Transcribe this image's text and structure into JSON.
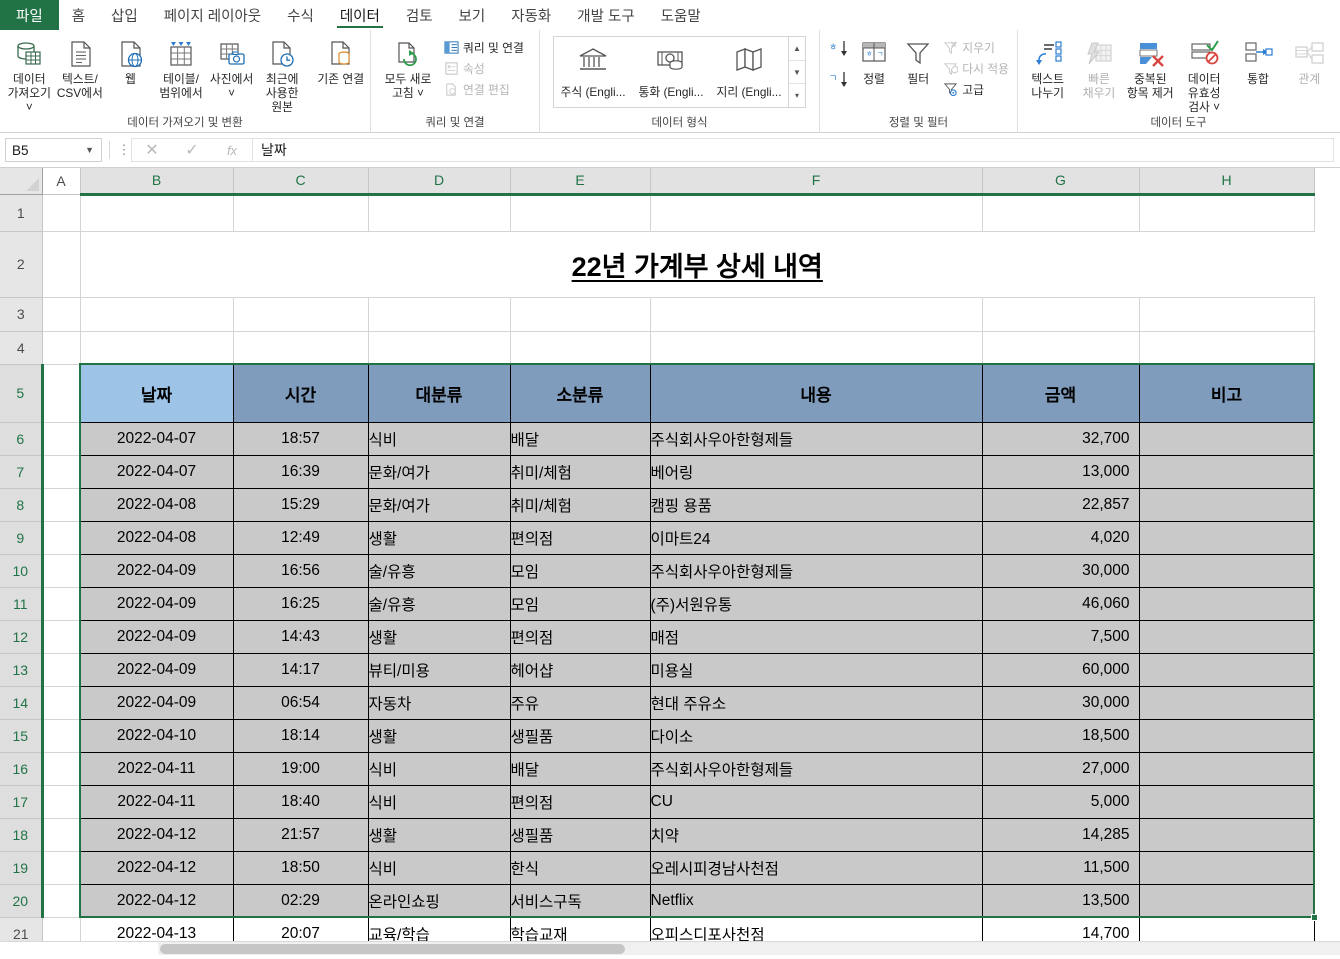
{
  "app": {
    "tabs": [
      {
        "label": "파일",
        "kind": "file"
      },
      {
        "label": "홈",
        "kind": "normal"
      },
      {
        "label": "삽입",
        "kind": "normal"
      },
      {
        "label": "페이지 레이아웃",
        "kind": "normal"
      },
      {
        "label": "수식",
        "kind": "normal"
      },
      {
        "label": "데이터",
        "kind": "active"
      },
      {
        "label": "검토",
        "kind": "normal"
      },
      {
        "label": "보기",
        "kind": "normal"
      },
      {
        "label": "자동화",
        "kind": "normal"
      },
      {
        "label": "개발 도구",
        "kind": "normal"
      },
      {
        "label": "도움말",
        "kind": "normal"
      }
    ]
  },
  "ribbon": {
    "groups": [
      {
        "name": "데이터 가져오기 및 변환"
      },
      {
        "name": "쿼리 및 연결"
      },
      {
        "name": "데이터 형식"
      },
      {
        "name": "정렬 및 필터"
      },
      {
        "name": "데이터 도구"
      }
    ],
    "get_transform": [
      {
        "label": "데이터 가져오기 ˅",
        "icon": "database-import-icon"
      },
      {
        "label": "텍스트/ CSV에서",
        "icon": "text-csv-icon"
      },
      {
        "label": "웹",
        "icon": "web-icon"
      },
      {
        "label": "테이블/ 범위에서",
        "icon": "table-range-icon"
      },
      {
        "label": "사진에서 ˅",
        "icon": "from-picture-icon"
      },
      {
        "label": "최근에 사용한 원본",
        "icon": "recent-sources-icon"
      },
      {
        "label": "기존 연결",
        "icon": "existing-connections-icon"
      }
    ],
    "queries": {
      "refresh_all": "모두 새로 고침 ˅",
      "items": [
        {
          "label": "쿼리 및 연결",
          "disabled": false,
          "icon": "queries-connections-icon"
        },
        {
          "label": "속성",
          "disabled": true,
          "icon": "properties-icon"
        },
        {
          "label": "연결 편집",
          "disabled": true,
          "icon": "edit-links-icon"
        }
      ]
    },
    "data_types": [
      {
        "label": "주식 (Engli...",
        "icon": "stocks-icon"
      },
      {
        "label": "통화 (Engli...",
        "icon": "currency-icon"
      },
      {
        "label": "지리 (Engli...",
        "icon": "geography-icon"
      }
    ],
    "sort_filter": {
      "sort_az": "sort-ascending-icon",
      "sort_za": "sort-descending-icon",
      "sort": "정렬",
      "filter": "필터",
      "items": [
        {
          "label": "지우기",
          "disabled": true,
          "icon": "clear-filter-icon"
        },
        {
          "label": "다시 적용",
          "disabled": true,
          "icon": "reapply-icon"
        },
        {
          "label": "고급",
          "disabled": false,
          "icon": "advanced-filter-icon"
        }
      ]
    },
    "data_tools": [
      {
        "label": "텍스트 나누기",
        "disabled": false,
        "icon": "text-to-columns-icon"
      },
      {
        "label": "빠른 채우기",
        "disabled": true,
        "icon": "flash-fill-icon"
      },
      {
        "label": "중복된 항목 제거",
        "disabled": false,
        "icon": "remove-duplicates-icon"
      },
      {
        "label": "데이터 유효성 검사 ˅",
        "disabled": false,
        "icon": "data-validation-icon"
      },
      {
        "label": "통합",
        "disabled": false,
        "icon": "consolidate-icon"
      },
      {
        "label": "관계",
        "disabled": true,
        "icon": "relationships-icon"
      }
    ]
  },
  "formula_bar": {
    "name_box": "B5",
    "formula": "날짜",
    "cancel_icon": "cancel-icon",
    "enter_icon": "enter-icon",
    "function_icon": "insert-function-icon"
  },
  "sheet": {
    "columns": [
      "A",
      "B",
      "C",
      "D",
      "E",
      "F",
      "G",
      "H"
    ],
    "selected_columns": [
      "B",
      "C",
      "D",
      "E",
      "F",
      "G",
      "H"
    ],
    "rows": [
      "1",
      "2",
      "3",
      "4",
      "5",
      "6",
      "7",
      "8",
      "9",
      "10",
      "11",
      "12",
      "13",
      "14",
      "15",
      "16",
      "17",
      "18",
      "19",
      "20",
      "21"
    ],
    "selected_rows": [
      "5",
      "6",
      "7",
      "8",
      "9",
      "10",
      "11",
      "12",
      "13",
      "14",
      "15",
      "16",
      "17",
      "18",
      "19",
      "20"
    ],
    "title": "22년 가계부 상세 내역 ",
    "table_headers": [
      "날짜",
      "시간",
      "대분류",
      "소분류",
      "내용",
      "금액",
      "비고"
    ],
    "active_cell": "B5",
    "selection_range": "B5:H20",
    "colors": {
      "header_fill": "#7f9cbd",
      "active_cell_fill": "#9dc3e6",
      "data_fill": "#c9c9c9",
      "selection_border": "#217346",
      "file_tab": "#217346"
    },
    "table_rows": [
      {
        "row": "6",
        "date": "2022-04-07",
        "time": "18:57",
        "major": "식비",
        "minor": "배달",
        "desc": "주식회사우아한형제들",
        "amount": "32,700",
        "note": ""
      },
      {
        "row": "7",
        "date": "2022-04-07",
        "time": "16:39",
        "major": "문화/여가",
        "minor": "취미/체험",
        "desc": "베어링",
        "amount": "13,000",
        "note": ""
      },
      {
        "row": "8",
        "date": "2022-04-08",
        "time": "15:29",
        "major": "문화/여가",
        "minor": "취미/체험",
        "desc": "캠핑 용품",
        "amount": "22,857",
        "note": ""
      },
      {
        "row": "9",
        "date": "2022-04-08",
        "time": "12:49",
        "major": "생활",
        "minor": "편의점",
        "desc": "이마트24",
        "amount": "4,020",
        "note": ""
      },
      {
        "row": "10",
        "date": "2022-04-09",
        "time": "16:56",
        "major": "술/유흥",
        "minor": "모임",
        "desc": "주식회사우아한형제들",
        "amount": "30,000",
        "note": ""
      },
      {
        "row": "11",
        "date": "2022-04-09",
        "time": "16:25",
        "major": "술/유흥",
        "minor": "모임",
        "desc": "(주)서원유통",
        "amount": "46,060",
        "note": ""
      },
      {
        "row": "12",
        "date": "2022-04-09",
        "time": "14:43",
        "major": "생활",
        "minor": "편의점",
        "desc": "매점",
        "amount": "7,500",
        "note": ""
      },
      {
        "row": "13",
        "date": "2022-04-09",
        "time": "14:17",
        "major": "뷰티/미용",
        "minor": "헤어샵",
        "desc": "미용실",
        "amount": "60,000",
        "note": ""
      },
      {
        "row": "14",
        "date": "2022-04-09",
        "time": "06:54",
        "major": "자동차",
        "minor": "주유",
        "desc": "현대 주유소",
        "amount": "30,000",
        "note": ""
      },
      {
        "row": "15",
        "date": "2022-04-10",
        "time": "18:14",
        "major": "생활",
        "minor": "생필품",
        "desc": "다이소",
        "amount": "18,500",
        "note": ""
      },
      {
        "row": "16",
        "date": "2022-04-11",
        "time": "19:00",
        "major": "식비",
        "minor": "배달",
        "desc": "주식회사우아한형제들",
        "amount": "27,000",
        "note": ""
      },
      {
        "row": "17",
        "date": "2022-04-11",
        "time": "18:40",
        "major": "식비",
        "minor": "편의점",
        "desc": "CU",
        "amount": "5,000",
        "note": ""
      },
      {
        "row": "18",
        "date": "2022-04-12",
        "time": "21:57",
        "major": "생활",
        "minor": "생필품",
        "desc": "치약",
        "amount": "14,285",
        "note": ""
      },
      {
        "row": "19",
        "date": "2022-04-12",
        "time": "18:50",
        "major": "식비",
        "minor": "한식",
        "desc": "오레시피경남사천점",
        "amount": "11,500",
        "note": ""
      },
      {
        "row": "20",
        "date": "2022-04-12",
        "time": "02:29",
        "major": "온라인쇼핑",
        "minor": "서비스구독",
        "desc": "Netflix",
        "amount": "13,500",
        "note": ""
      },
      {
        "row": "21",
        "date": "2022-04-13",
        "time": "20:07",
        "major": "교육/학습",
        "minor": "학습교재",
        "desc": "오피스디포사천점",
        "amount": "14,700",
        "note": ""
      }
    ]
  }
}
